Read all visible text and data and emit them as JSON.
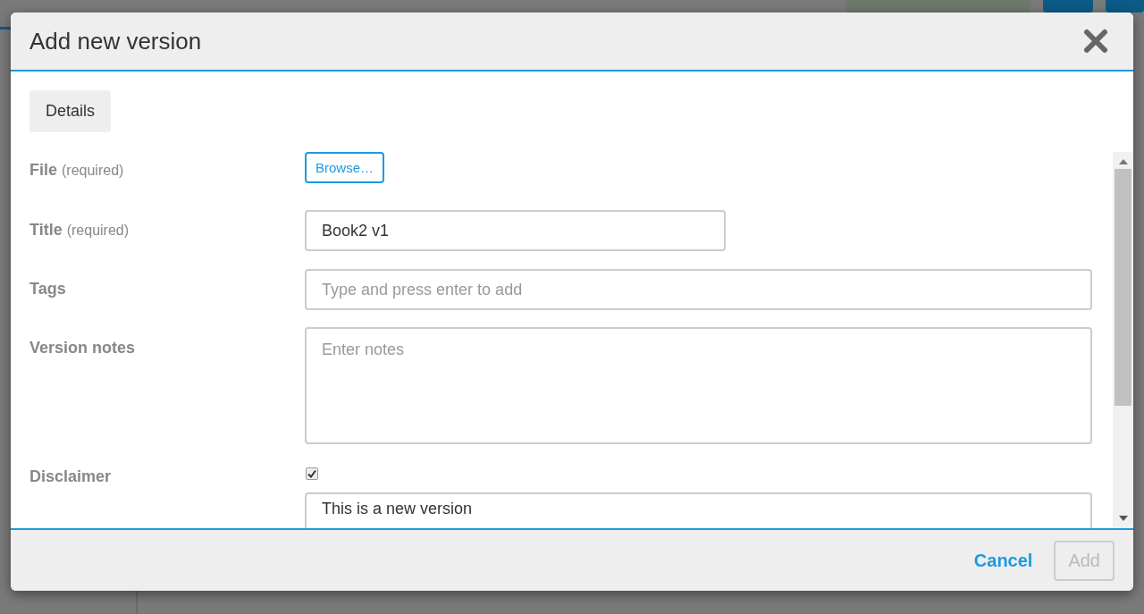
{
  "dialog": {
    "title": "Add new version"
  },
  "tabs": [
    {
      "label": "Details",
      "selected": true
    }
  ],
  "fields": [
    {
      "kind": "file",
      "label": "File",
      "note": "(required)",
      "button": "Browse…"
    },
    {
      "kind": "text",
      "label": "Title",
      "note": "(required)",
      "value": "Book2 v1",
      "wide": false
    },
    {
      "kind": "text",
      "label": "Tags",
      "placeholder": "Type and press enter to add",
      "wide": true
    },
    {
      "kind": "textarea",
      "label": "Version notes",
      "placeholder": "Enter notes"
    },
    {
      "kind": "checkbox",
      "label": "Disclaimer",
      "checked": true,
      "value": "This is a new version"
    }
  ],
  "footer": {
    "cancel": "Cancel",
    "add": {
      "label": "Add",
      "disabled": true
    }
  }
}
